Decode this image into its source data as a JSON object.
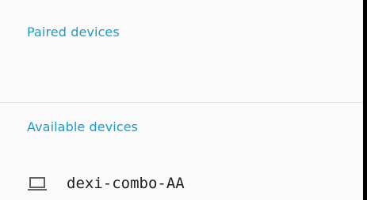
{
  "sections": {
    "paired_title": "Paired devices",
    "available_title": "Available devices"
  },
  "available_devices": [
    {
      "name": "dexi-combo-AA",
      "icon": "laptop-icon"
    }
  ],
  "colors": {
    "section_header": "#1e9bc4",
    "background": "#fafafa",
    "divider": "#dddddd",
    "icon": "#5f6368",
    "text": "#202020"
  }
}
